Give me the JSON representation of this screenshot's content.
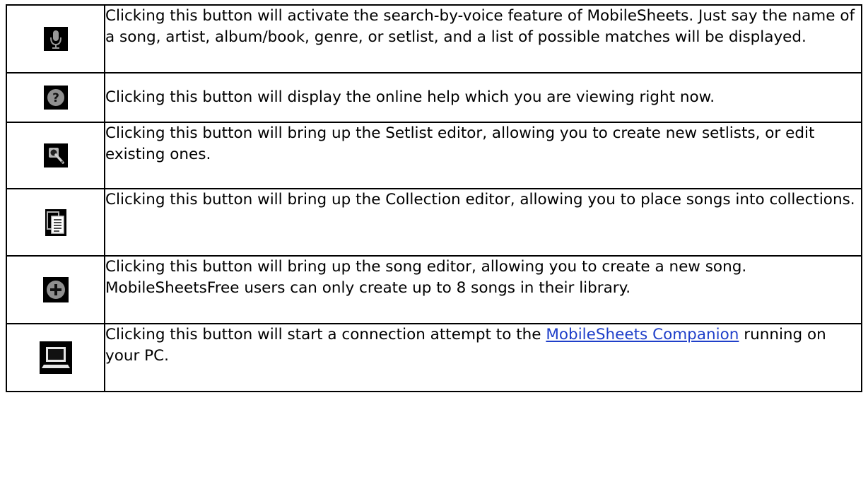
{
  "rows": [
    {
      "icon": "microphone-icon",
      "text": "Clicking this button will activate the search-by-voice feature of MobileSheets. Just say the name of a song, artist, album/book, genre, or setlist, and a list of possible matches will be displayed."
    },
    {
      "icon": "help-question-icon",
      "text": "Clicking this button will display the online help which you are viewing right now."
    },
    {
      "icon": "setlist-editor-icon",
      "text": "Clicking this button will bring up the Setlist editor, allowing you to create new setlists, or edit existing ones."
    },
    {
      "icon": "collection-editor-icon",
      "text": "Clicking this button will bring up the Collection editor, allowing you to place songs into collections."
    },
    {
      "icon": "add-song-icon",
      "text": "Clicking this button will bring up the song editor, allowing you to create a new song. MobileSheetsFree users can only create up to 8 songs in their library."
    },
    {
      "icon": "computer-connection-icon",
      "text_before": "Clicking this button will start a connection attempt to the ",
      "link": "MobileSheets Companion",
      "text_after": " running on your PC."
    }
  ]
}
